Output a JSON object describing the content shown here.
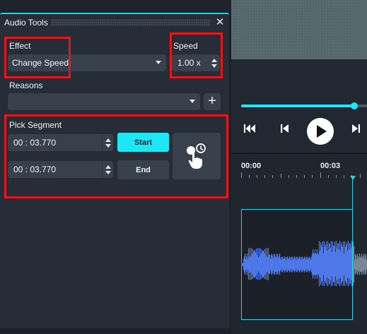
{
  "panel": {
    "title": "Audio Tools",
    "close_symbol": "✕"
  },
  "effect": {
    "label": "Effect",
    "value": "Change Speed"
  },
  "speed": {
    "label": "Speed",
    "value": "1.00 x"
  },
  "reasons": {
    "label": "Reasons",
    "value": "",
    "add_symbol": "+"
  },
  "segment": {
    "label": "Pick Segment",
    "start_time": "00 : 03.770",
    "end_time": "00 : 03.770",
    "start_label": "Start",
    "end_label": "End"
  },
  "player": {
    "seek_progress": 0.9
  },
  "timeline": {
    "ruler": [
      "00:00",
      "00:03"
    ]
  },
  "colors": {
    "accent": "#1ee6f5",
    "highlight_box": "#e0191c",
    "waveform": "#4f78e8",
    "panel_bg": "#262d37"
  },
  "icons": [
    "close-icon",
    "dropdown-caret-icon",
    "spin-up-icon",
    "spin-down-icon",
    "plus-icon",
    "touch-clock-icon",
    "skip-start-icon",
    "step-back-icon",
    "play-icon",
    "step-forward-icon"
  ]
}
